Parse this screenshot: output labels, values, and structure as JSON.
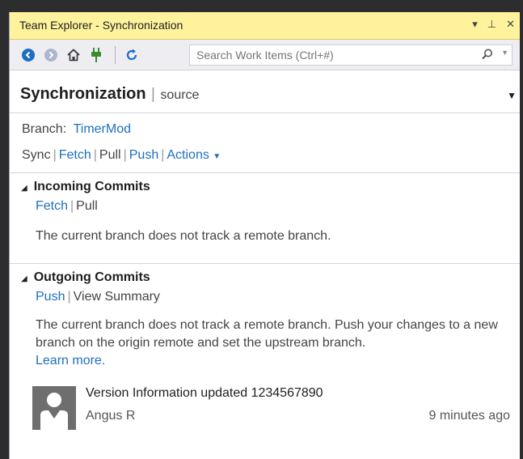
{
  "window": {
    "title": "Team Explorer - Synchronization",
    "dropdown_glyph": "▾",
    "pin_glyph": "⊥",
    "close_glyph": "✕"
  },
  "toolbar": {
    "search_placeholder": "Search Work Items (Ctrl+#)",
    "icons": [
      "back-icon",
      "forward-icon",
      "home-icon",
      "connect-icon",
      "refresh-icon",
      "search-icon"
    ]
  },
  "header": {
    "title": "Synchronization",
    "separator": "|",
    "subtitle": "source"
  },
  "branch": {
    "label": "Branch:",
    "name": "TimerMod"
  },
  "actions": {
    "sync": "Sync",
    "fetch": "Fetch",
    "pull": "Pull",
    "push": "Push",
    "more": "Actions"
  },
  "incoming": {
    "title": "Incoming Commits",
    "fetch": "Fetch",
    "pull": "Pull",
    "message": "The current branch does not track a remote branch."
  },
  "outgoing": {
    "title": "Outgoing Commits",
    "push": "Push",
    "view_summary": "View Summary",
    "message": "The current branch does not track a remote branch. Push your changes to a new branch on the origin remote and set the upstream branch.",
    "learn_more": "Learn more."
  },
  "commit": {
    "message": "Version Information updated  1234567890",
    "author": "Angus R",
    "time": "9 minutes ago"
  },
  "colors": {
    "title_bar": "#fff29d",
    "link": "#1e6fbf",
    "nav_blue": "#1c6dc4",
    "connect_green": "#3c8a2e"
  }
}
